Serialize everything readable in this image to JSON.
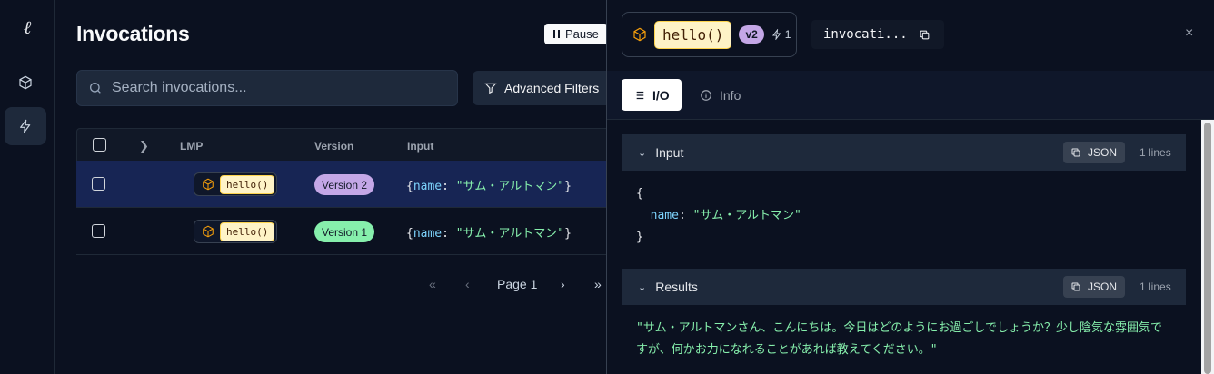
{
  "rail": {
    "logo": "ℓ"
  },
  "main": {
    "title": "Invocations",
    "pause_label": "Pause",
    "search_placeholder": "Search invocations...",
    "filters_label": "Advanced Filters",
    "columns": {
      "lmp": "LMP",
      "version": "Version",
      "input": "Input"
    },
    "rows": [
      {
        "lmp": "hello()",
        "version": "Version 2",
        "input_key": "name",
        "input_value": "\"サム・アルトマン\"",
        "selected": true
      },
      {
        "lmp": "hello()",
        "version": "Version 1",
        "input_key": "name",
        "input_value": "\"サム・アルトマン\"",
        "selected": false
      }
    ],
    "pager": {
      "first": "«",
      "prev": "‹",
      "label": "Page 1",
      "next": "›",
      "last": "»"
    }
  },
  "panel": {
    "lmp_name": "hello()",
    "version_badge": "v2",
    "invocation_count": "1",
    "invocation_id": "invocati...",
    "close": "×",
    "tabs": [
      {
        "label": "I/O",
        "active": true
      },
      {
        "label": "Info",
        "active": false
      }
    ],
    "input_section": {
      "title": "Input",
      "json_label": "JSON",
      "lines_label": "1 lines",
      "open_brace": "{",
      "key": "name",
      "value": "\"サム・アルトマン\"",
      "close_brace": "}"
    },
    "results_section": {
      "title": "Results",
      "json_label": "JSON",
      "lines_label": "1 lines",
      "text": "\"サム・アルトマンさん、こんにちは。今日はどのようにお過ごしでしょうか？少し陰気な雰囲気ですが、何かお力になれることがあれば教えてください。\""
    }
  },
  "colors": {
    "background": "#0b1120",
    "accent_amber": "#f59e0b",
    "version2": "#c4a7e7",
    "version1": "#86efac",
    "selected_row": "#172554"
  }
}
